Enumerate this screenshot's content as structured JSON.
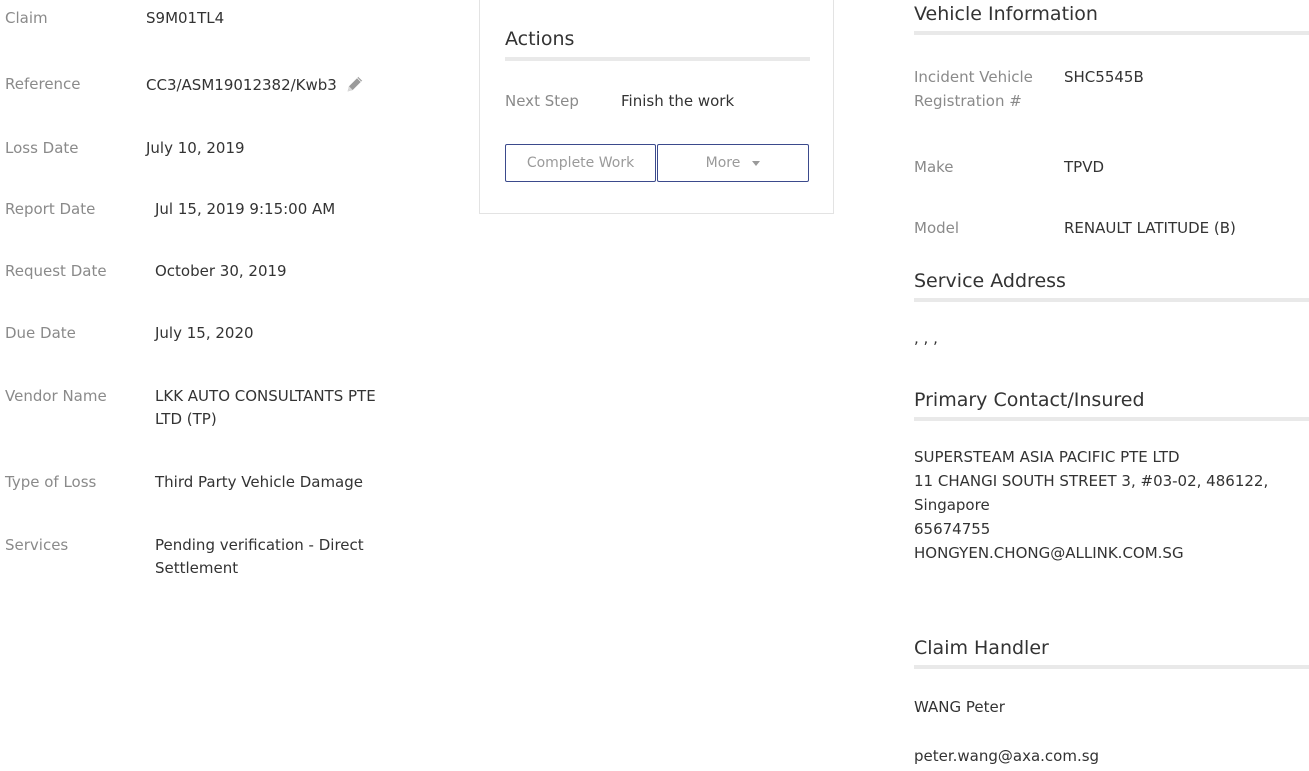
{
  "claim_details": {
    "claim_label": "Claim",
    "claim_value": "S9M01TL4",
    "reference_label": "Reference",
    "reference_value": "CC3/ASM19012382/Kwb3",
    "loss_date_label": "Loss Date",
    "loss_date_value": "July 10, 2019",
    "report_date_label": "Report Date",
    "report_date_value": "Jul 15, 2019 9:15:00 AM",
    "request_date_label": "Request Date",
    "request_date_value": "October 30, 2019",
    "due_date_label": "Due Date",
    "due_date_value": "July 15, 2020",
    "vendor_name_label": "Vendor Name",
    "vendor_name_line1": "LKK AUTO CONSULTANTS PTE",
    "vendor_name_line2": "LTD (TP)",
    "type_of_loss_label": "Type of Loss",
    "type_of_loss_value": "Third Party Vehicle Damage",
    "services_label": "Services",
    "services_line1": "Pending verification - Direct",
    "services_line2": "Settlement"
  },
  "actions": {
    "title": "Actions",
    "next_step_label": "Next Step",
    "next_step_value": "Finish the work",
    "complete_button": "Complete Work",
    "more_button": "More"
  },
  "vehicle_info": {
    "title": "Vehicle Information",
    "registration_label_line1": "Incident Vehicle",
    "registration_label_line2": "Registration #",
    "registration_value": "SHC5545B",
    "make_label": "Make",
    "make_value": "TPVD",
    "model_label": "Model",
    "model_value": "RENAULT LATITUDE (B)"
  },
  "service_address": {
    "title": "Service Address",
    "value": ", , ,"
  },
  "primary_contact": {
    "title": "Primary Contact/Insured",
    "name": "SUPERSTEAM ASIA PACIFIC PTE LTD",
    "address_line1": "11 CHANGI SOUTH STREET 3, #03-02, 486122,",
    "address_line2": "Singapore",
    "phone": "65674755",
    "email": "HONGYEN.CHONG@ALLINK.COM.SG"
  },
  "claim_handler": {
    "title": "Claim Handler",
    "name": "WANG Peter",
    "email": "peter.wang@axa.com.sg"
  },
  "icons": {
    "edit": "pencil-icon",
    "dropdown": "caret-down-icon"
  },
  "colors": {
    "link": "#2c4a66",
    "button_border": "#3b4a8c",
    "label": "#8a8a8a"
  }
}
